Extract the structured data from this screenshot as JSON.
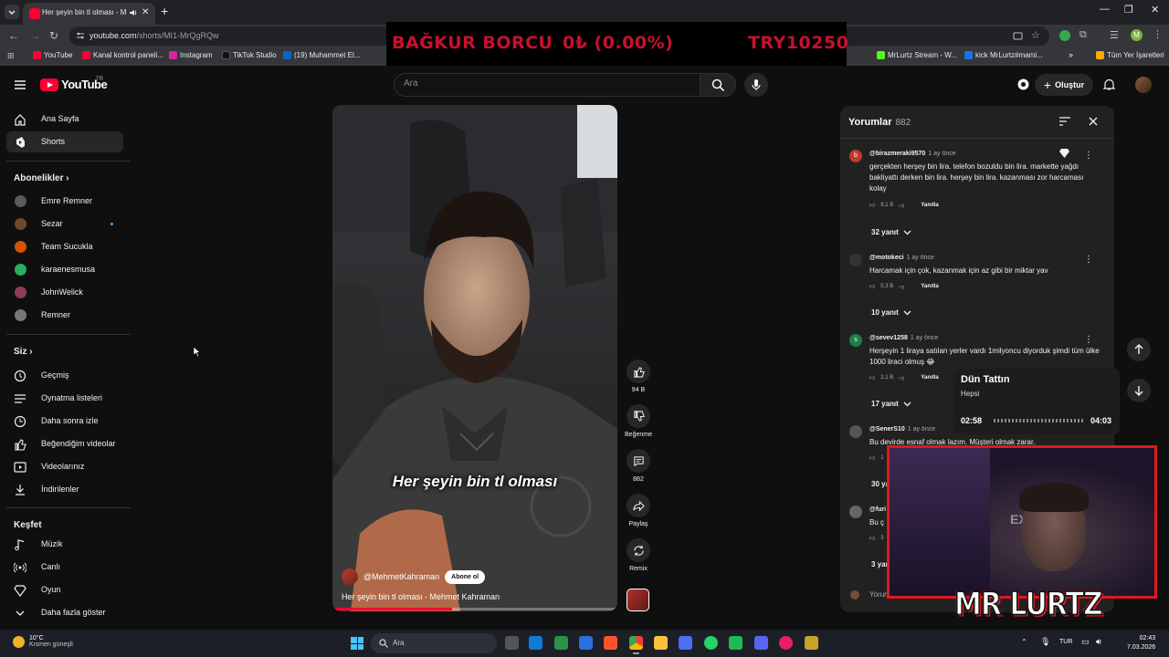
{
  "browser": {
    "tab_title": "Her şeyin bin tl olması - Mehmet Kahraman",
    "url_host": "youtube.com",
    "url_path": "/shorts/MI1-MrQgRQw",
    "bookmarks": [
      "YouTube",
      "Kanal kontrol paneli...",
      "Instagram",
      "TikTok Studio",
      "(19) Muhammet El...",
      "MrLurtz Stream - W...",
      "kick MrLurtz#mami...",
      "Tüm Yer İşaretleri"
    ]
  },
  "ticker": {
    "label": "BAĞKUR BORCU",
    "change": "0₺ (0.00%)",
    "amount": "TRY10250"
  },
  "youtube": {
    "logo_text": "YouTube",
    "country_code": "TR",
    "search_placeholder": "Ara",
    "create_label": "Oluştur"
  },
  "sidebar": {
    "main": [
      {
        "label": "Ana Sayfa",
        "icon": "home-icon"
      },
      {
        "label": "Shorts",
        "icon": "shorts-icon"
      }
    ],
    "subscriptions_title": "Abonelikler",
    "subscriptions": [
      "Emre Remner",
      "Sezar",
      "Team Sucukla",
      "karaenesmusa",
      "JohnWelick",
      "Remner"
    ],
    "you_title": "Siz",
    "you": [
      {
        "label": "Geçmiş",
        "icon": "history-icon"
      },
      {
        "label": "Oynatma listeleri",
        "icon": "playlist-icon"
      },
      {
        "label": "Daha sonra izle",
        "icon": "clock-icon"
      },
      {
        "label": "Beğendiğim videolar",
        "icon": "thumb-up-icon"
      },
      {
        "label": "Videolarınız",
        "icon": "video-icon"
      },
      {
        "label": "İndirilenler",
        "icon": "download-icon"
      }
    ],
    "explore_title": "Keşfet",
    "explore": [
      {
        "label": "Müzik",
        "icon": "music-icon"
      },
      {
        "label": "Canlı",
        "icon": "live-icon"
      },
      {
        "label": "Oyun",
        "icon": "gaming-icon"
      },
      {
        "label": "Daha fazla göster",
        "icon": "chevron-down-icon"
      }
    ]
  },
  "video": {
    "caption": "Her şeyin bin tl olması",
    "channel": "@MehmetKahraman",
    "subscribe_label": "Abone ol",
    "title": "Her şeyin bin tl olması - Mehmet Kahraman",
    "progress": 0.42,
    "actions": {
      "likes": "94 B",
      "dislike_label": "Beğenme",
      "comments": "882",
      "share_label": "Paylaş",
      "remix_label": "Remix"
    }
  },
  "comments": {
    "title": "Yorumlar",
    "count": "882",
    "input_placeholder": "Yorum ekleyin...",
    "items": [
      {
        "user": "@birazmeraki9570",
        "time": "1 ay önce",
        "avatar_letter": "b",
        "avatar_color": "#c0392b",
        "text": "gerçekten herşey bin lira. telefon bozuldu bin lira. markette yağdı bakliyattı derken bin lira. herşey bin lira. kazanması zor harcaması kolay",
        "likes": "9,1 B",
        "reply": "Yanıtla",
        "replies": "32 yanıt"
      },
      {
        "user": "@motokeci",
        "time": "1 ay önce",
        "avatar_letter": "",
        "avatar_color": "#333333",
        "text": "Harcamak için çok, kazanmak için az gibi bir miktar yav",
        "likes": "5,3 B",
        "reply": "Yanıtla",
        "replies": "10 yanıt"
      },
      {
        "user": "@sevev1258",
        "time": "1 ay önce",
        "avatar_letter": "s",
        "avatar_color": "#1e7e4a",
        "text": "Herşeyin 1 liraya satılan yerler  vardı 1milyoncu diyorduk şimdi tüm ülke 1000 liraci olmuş 😂",
        "likes": "2,1 B",
        "reply": "Yanıtla",
        "replies": "17 yanıt"
      },
      {
        "user": "@SenerS10",
        "time": "1 ay önce",
        "avatar_letter": "",
        "avatar_color": "#555555",
        "text": "Bu devirde esnaf olmak lazım. Müşteri olmak zarar.",
        "likes": "1",
        "reply": "Yanıtla",
        "replies": "30 yanıt"
      },
      {
        "user": "@furi",
        "time": "",
        "avatar_letter": "",
        "avatar_color": "#666666",
        "text": "Bu ç",
        "likes": "3",
        "reply": "",
        "replies": "3 yanıt"
      }
    ]
  },
  "media_popup": {
    "title": "Dün Tattın",
    "artist": "Hepsi",
    "current": "02:58",
    "end": "04:03"
  },
  "stream_overlay": {
    "cam_text": "EXY",
    "brand": "MR LURTZ"
  },
  "taskbar": {
    "weather_temp": "10°C",
    "weather_desc": "Kısmen güneşli",
    "search_label": "Ara",
    "lang": "TUR",
    "time": "02:43",
    "date": "7.03.2026"
  },
  "colors": {
    "yt_red": "#ff0033",
    "ticker_red": "#c8102e",
    "overlay_red": "#e0191e",
    "link_blue": "#3ea6ff"
  }
}
